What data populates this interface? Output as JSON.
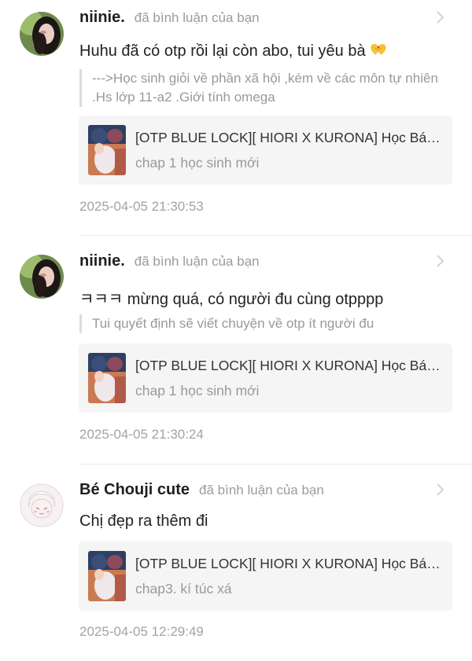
{
  "notifications": [
    {
      "user": "niinie.",
      "action": "đã bình luận của bạn",
      "comment": "Huhu đã có otp rồi lại còn abo, tui yêu bà",
      "comment_emoji": "heart-hands-emoji",
      "quote": "--->Học sinh giỏi về phần xã hội ,kém về các môn tự nhiên .Hs lớp 11-a2 .Giới tính omega",
      "story_title": "[OTP BLUE LOCK][ HIORI X KURONA] Học Bá ...",
      "chapter": "chap 1 học sinh mới",
      "time": "2025-04-05 21:30:53"
    },
    {
      "user": "niinie.",
      "action": "đã bình luận của bạn",
      "comment": "ㅋㅋㅋ mừng quá, có người đu cùng otpppp",
      "quote": "Tui quyết định sẽ viết chuyện về otp ít người đu",
      "story_title": "[OTP BLUE LOCK][ HIORI X KURONA] Học Bá ...",
      "chapter": "chap 1 học sinh mới",
      "time": "2025-04-05 21:30:24"
    },
    {
      "user": "Bé Chouji cute",
      "action": "đã bình luận của bạn",
      "comment": "Chị đẹp ra thêm đi",
      "story_title": "[OTP BLUE LOCK][ HIORI X KURONA] Học Bá ...",
      "chapter": "chap3. kí túc xá",
      "time": "2025-04-05 12:29:49"
    }
  ],
  "colors": {
    "username": "#1f1f1f",
    "muted": "#9b9b9b",
    "card_bg": "#f5f5f5",
    "divider": "#ececec"
  }
}
